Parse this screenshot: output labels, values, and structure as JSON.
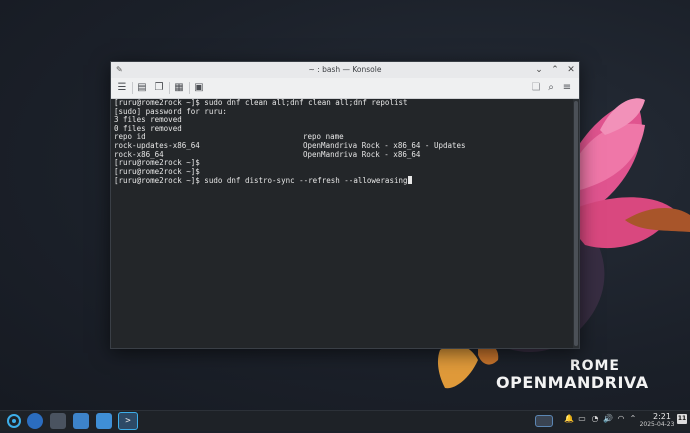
{
  "window": {
    "title": "~ : bash — Konsole"
  },
  "terminal": {
    "lines": [
      {
        "a": "[ruru@rome2rock ~]$ sudo dnf clean all;dnf clean all;dnf repolist",
        "b": ""
      },
      {
        "a": "[sudo] password for ruru:",
        "b": ""
      },
      {
        "a": "3 files removed",
        "b": ""
      },
      {
        "a": "0 files removed",
        "b": ""
      },
      {
        "a": "repo id",
        "b": "repo name"
      },
      {
        "a": "rock-updates-x86_64",
        "b": "OpenMandriva Rock - x86_64 - Updates"
      },
      {
        "a": "rock-x86_64",
        "b": "OpenMandriva Rock - x86_64"
      },
      {
        "a": "[ruru@rome2rock ~]$",
        "b": ""
      },
      {
        "a": "[ruru@rome2rock ~]$",
        "b": ""
      },
      {
        "a": "[ruru@rome2rock ~]$ sudo dnf distro-sync --refresh --allowerasing",
        "b": ""
      }
    ]
  },
  "branding": {
    "rome": "ROME",
    "openmandriva": "OPENMANDRIVA"
  },
  "taskbar": {
    "time": "2:21",
    "date": "2025-04-23",
    "badge": "11"
  },
  "colors": {
    "accent": "#3daee9",
    "terminal_bg": "#232629",
    "terminal_fg": "#e6e6e6"
  }
}
